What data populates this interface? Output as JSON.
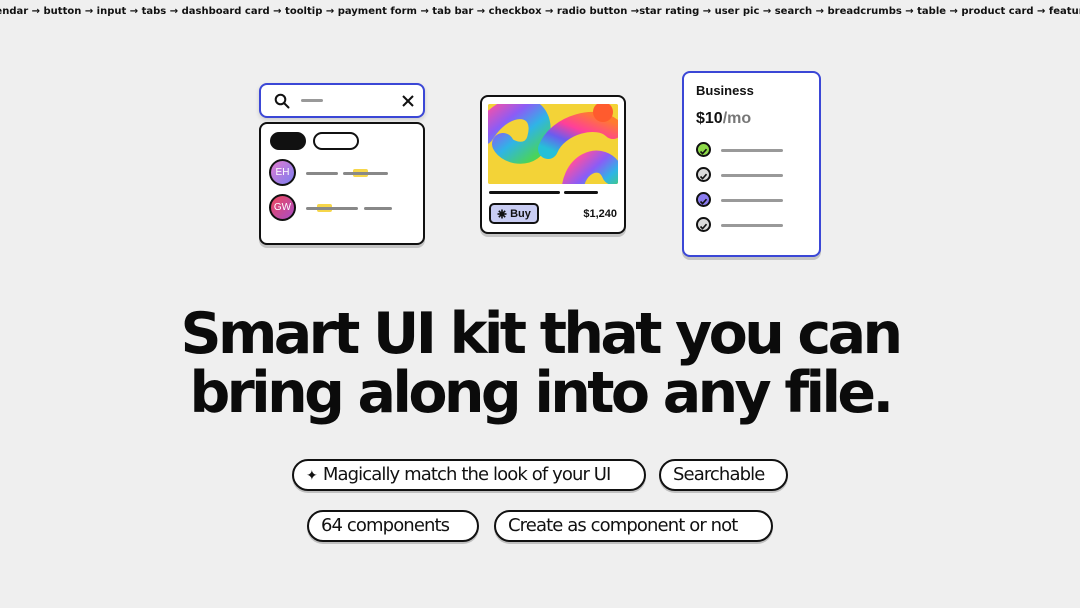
{
  "ticker": {
    "text": "lendar → button → input → tabs → dashboard card → tooltip → payment form → tab bar → checkbox → radio button →star rating → user pic → search → breadcrumbs → table → product card → feature card → list item → p"
  },
  "search_card": {
    "users": [
      {
        "initials": "EH"
      },
      {
        "initials": "GW"
      }
    ]
  },
  "product_card": {
    "buy_label": "Buy",
    "price": "$1,240"
  },
  "pricing_card": {
    "plan": "Business",
    "amount": "$10",
    "period": "/mo",
    "check_colors": [
      "#8edb4a",
      "#d9d9d9",
      "#8b7cf0",
      "#d9d9d9"
    ]
  },
  "headline": {
    "line1": "Smart UI kit that you can",
    "line2": "bring along into any file."
  },
  "features": {
    "match_look": "Magically match the look of your UI",
    "searchable": "Searchable",
    "components": "64 components",
    "create": "Create as component or not"
  },
  "colors": {
    "background": "#efefef",
    "accent_blue": "#3b47d6",
    "highlight_yellow": "#f6d64a"
  }
}
